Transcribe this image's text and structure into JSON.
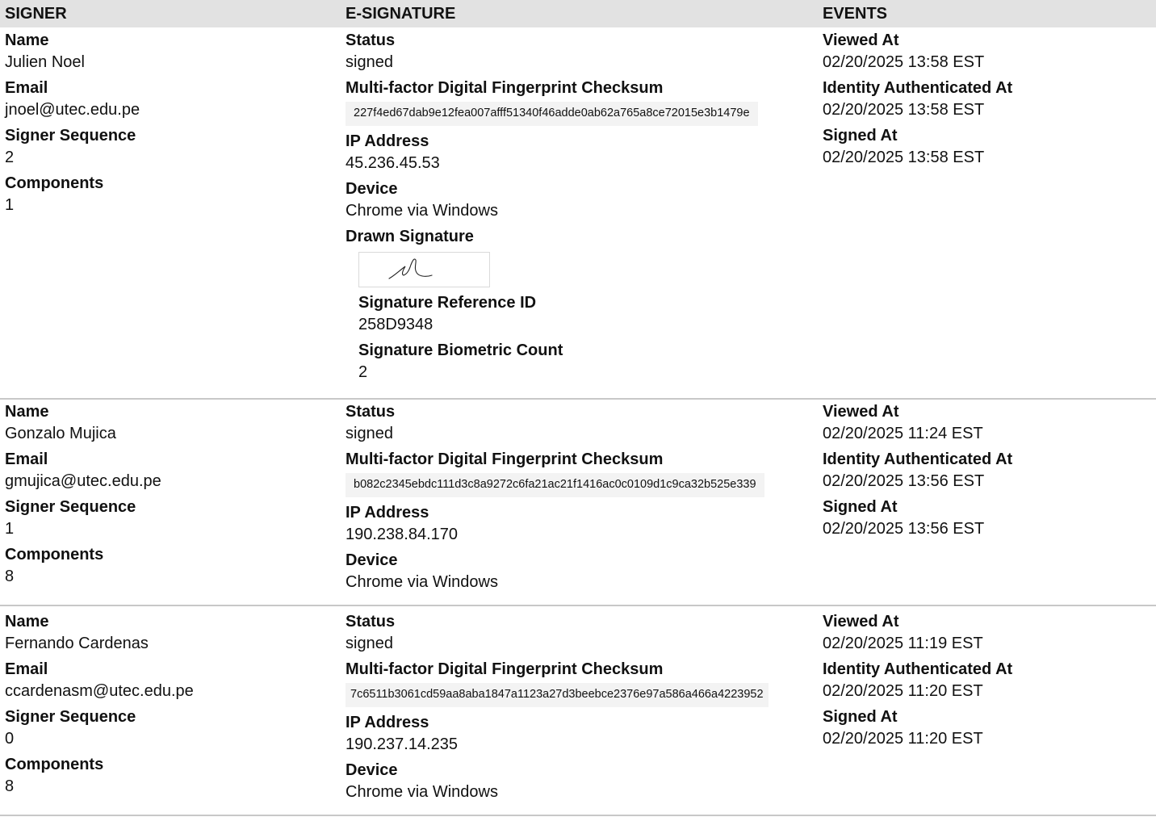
{
  "headers": {
    "signer": "SIGNER",
    "esignature": "E-SIGNATURE",
    "events": "EVENTS"
  },
  "labels": {
    "name": "Name",
    "email": "Email",
    "signer_sequence": "Signer Sequence",
    "components": "Components",
    "status": "Status",
    "checksum": "Multi-factor Digital Fingerprint Checksum",
    "ip_address": "IP Address",
    "device": "Device",
    "drawn_signature": "Drawn Signature",
    "signature_reference_id": "Signature Reference ID",
    "signature_biometric_count": "Signature Biometric Count",
    "viewed_at": "Viewed At",
    "identity_authenticated_at": "Identity Authenticated At",
    "signed_at": "Signed At"
  },
  "signers": [
    {
      "name": "Julien Noel",
      "email": "jnoel@utec.edu.pe",
      "signer_sequence": "2",
      "components": "1",
      "status": "signed",
      "checksum": "227f4ed67dab9e12fea007afff51340f46adde0ab62a765a8ce72015e3b1479e",
      "ip_address": "45.236.45.53",
      "device": "Chrome via Windows",
      "signature_reference_id": "258D9348",
      "signature_biometric_count": "2",
      "viewed_at": "02/20/2025 13:58 EST",
      "identity_authenticated_at": "02/20/2025 13:58 EST",
      "signed_at": "02/20/2025 13:58 EST"
    },
    {
      "name": "Gonzalo Mujica",
      "email": "gmujica@utec.edu.pe",
      "signer_sequence": "1",
      "components": "8",
      "status": "signed",
      "checksum": "b082c2345ebdc111d3c8a9272c6fa21ac21f1416ac0c0109d1c9ca32b525e339",
      "ip_address": "190.238.84.170",
      "device": "Chrome via Windows",
      "viewed_at": "02/20/2025 11:24 EST",
      "identity_authenticated_at": "02/20/2025 13:56 EST",
      "signed_at": "02/20/2025 13:56 EST"
    },
    {
      "name": "Fernando Cardenas",
      "email": "ccardenasm@utec.edu.pe",
      "signer_sequence": "0",
      "components": "8",
      "status": "signed",
      "checksum": "7c6511b3061cd59aa8aba1847a1123a27d3beebce2376e97a586a466a4223952",
      "ip_address": "190.237.14.235",
      "device": "Chrome via Windows",
      "viewed_at": "02/20/2025 11:19 EST",
      "identity_authenticated_at": "02/20/2025 11:20 EST",
      "signed_at": "02/20/2025 11:20 EST"
    }
  ]
}
